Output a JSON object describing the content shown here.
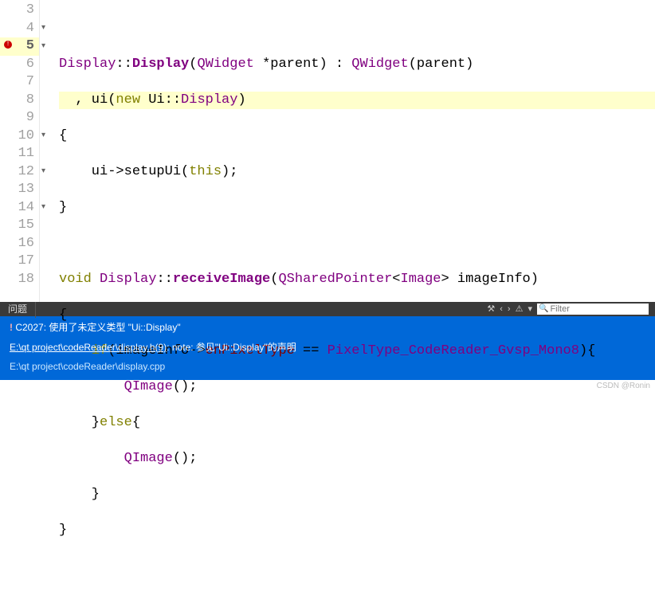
{
  "editor": {
    "lines": {
      "n3": "3",
      "n4": "4",
      "n5": "5",
      "n6": "6",
      "n7": "7",
      "n8": "8",
      "n9": "9",
      "n10": "10",
      "n11": "11",
      "n12": "12",
      "n13": "13",
      "n14": "14",
      "n15": "15",
      "n16": "16",
      "n17": "17",
      "n18": "18"
    }
  },
  "code": {
    "l4": {
      "a": "Display",
      "b": "::",
      "c": "Display",
      "d": "(",
      "e": "QWidget",
      "f": " *parent) : ",
      "g": "QWidget",
      "h": "(parent)"
    },
    "l5": {
      "a": "  , ui(",
      "b": "new",
      "c": " Ui::",
      "d": "Display",
      "e": ")"
    },
    "l6": "{",
    "l7": {
      "a": "    ui->setupUi(",
      "b": "this",
      "c": ");"
    },
    "l8": "}",
    "l10": {
      "a": "void",
      "b": " ",
      "c": "Display",
      "d": "::",
      "e": "receiveImage",
      "f": "(",
      "g": "QSharedPointer",
      "h": "<",
      "i": "Image",
      "j": "> imageInfo)"
    },
    "l11": "{",
    "l12": {
      "a": "    ",
      "b": "if",
      "c": "(imageInfo->",
      "d": "enPixelType",
      "e": " == ",
      "f": "PixelType_CodeReader_Gvsp_Mono8",
      "g": "){"
    },
    "l13": {
      "a": "        ",
      "b": "QImage",
      "c": "();"
    },
    "l14": {
      "a": "    }",
      "b": "else",
      "c": "{"
    },
    "l15": {
      "a": "        ",
      "b": "QImage",
      "c": "();"
    },
    "l16": "    }",
    "l17": "}"
  },
  "panel": {
    "title": "问题",
    "filter_placeholder": "Filter"
  },
  "messages": {
    "row1": {
      "icon": "!",
      "text": "C2027: 使用了未定义类型 \"Ui::Display\""
    },
    "row2": {
      "link": "E:\\qt project\\codeReader\\display.h(9)",
      "text": ": note: 参见\"Ui::Display\"的声明"
    },
    "row3": "E:\\qt project\\codeReader\\display.cpp"
  },
  "watermark": "CSDN @Ronin"
}
